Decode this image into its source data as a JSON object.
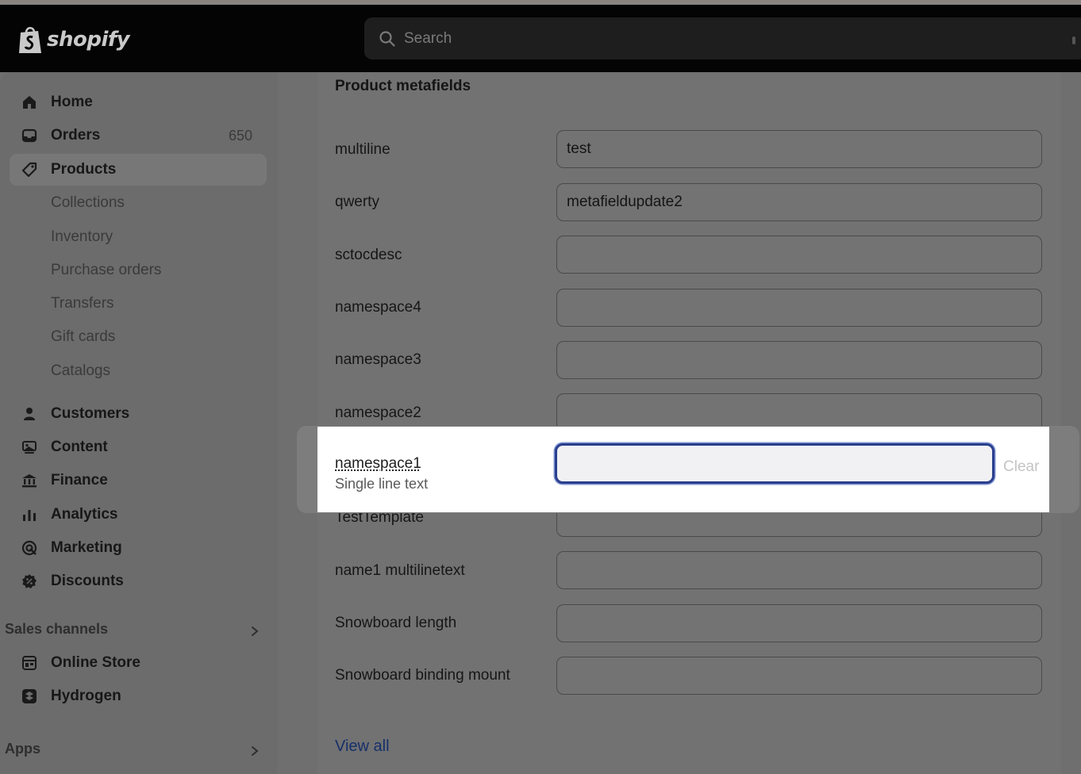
{
  "brand": {
    "name": "shopify"
  },
  "search": {
    "placeholder": "Search"
  },
  "sidebar": {
    "items": [
      {
        "label": "Home",
        "icon": "home-icon"
      },
      {
        "label": "Orders",
        "icon": "orders-icon",
        "count": "650"
      },
      {
        "label": "Products",
        "icon": "tag-icon",
        "active": true
      },
      {
        "label": "Collections"
      },
      {
        "label": "Inventory"
      },
      {
        "label": "Purchase orders"
      },
      {
        "label": "Transfers"
      },
      {
        "label": "Gift cards"
      },
      {
        "label": "Catalogs"
      },
      {
        "label": "Customers",
        "icon": "person-icon"
      },
      {
        "label": "Content",
        "icon": "content-icon"
      },
      {
        "label": "Finance",
        "icon": "bank-icon"
      },
      {
        "label": "Analytics",
        "icon": "bar-chart-icon"
      },
      {
        "label": "Marketing",
        "icon": "target-icon"
      },
      {
        "label": "Discounts",
        "icon": "discount-icon"
      }
    ],
    "sales_channels": {
      "title": "Sales channels",
      "items": [
        {
          "label": "Online Store",
          "icon": "store-icon"
        },
        {
          "label": "Hydrogen",
          "icon": "hydrogen-icon"
        }
      ]
    },
    "apps": {
      "title": "Apps"
    }
  },
  "metafields": {
    "title": "Product metafields",
    "fields": [
      {
        "label": "multiline",
        "value": "test"
      },
      {
        "label": "qwerty",
        "value": "metafieldupdate2"
      },
      {
        "label": "sctocdesc",
        "value": ""
      },
      {
        "label": "namespace4",
        "value": ""
      },
      {
        "label": "namespace3",
        "value": ""
      },
      {
        "label": "namespace2",
        "value": ""
      },
      {
        "label": "TestTemplate",
        "value": ""
      },
      {
        "label": "name1 multilinetext",
        "value": ""
      },
      {
        "label": "Snowboard length",
        "value": ""
      },
      {
        "label": "Snowboard binding mount",
        "value": ""
      }
    ],
    "focused": {
      "label": "namespace1",
      "type": "Single line text",
      "value": "",
      "clear_label": "Clear"
    },
    "view_all": "View all"
  },
  "colors": {
    "accent_focus": "#2a3f8e",
    "link": "#16306a"
  }
}
